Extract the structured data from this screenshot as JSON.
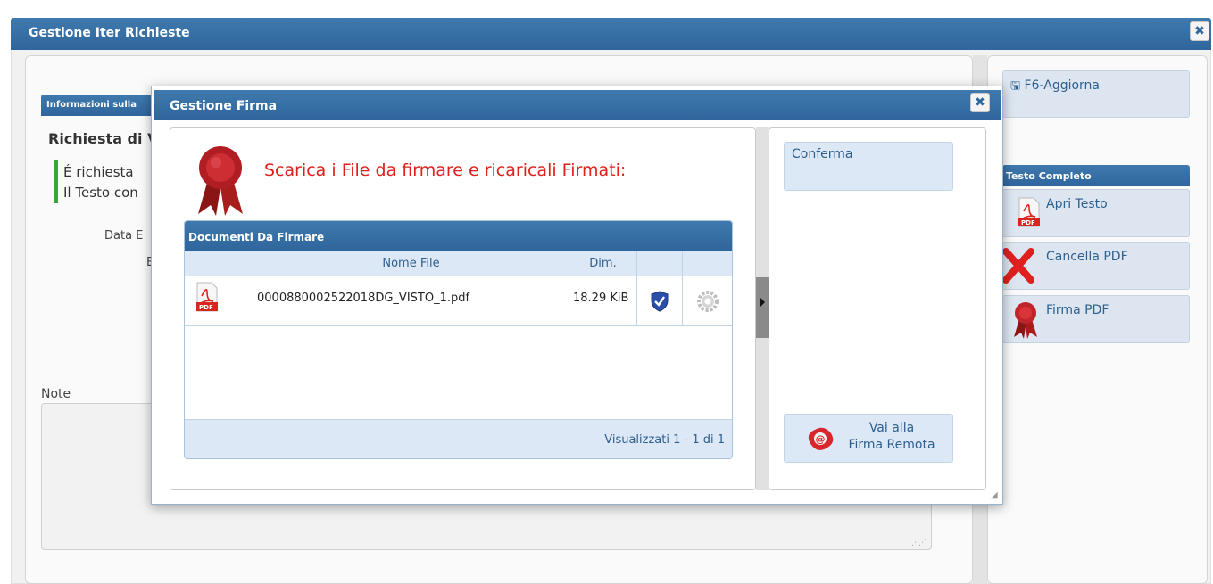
{
  "outer_window": {
    "title": "Gestione Iter Richieste",
    "close_glyph": "✖",
    "info_header": "Informazioni sulla",
    "richiesta_title": "Richiesta di V",
    "lines": [
      "É richiesta",
      "Il Testo con"
    ],
    "data_label": "Data E",
    "e_label": "E",
    "note_label": "Note"
  },
  "right_panel": {
    "aggiorna_label": "F6-Aggiorna",
    "testo_header": "Testo Completo",
    "apri_label": "Apri Testo",
    "cancella_label": "Cancella PDF",
    "firma_label": "Firma PDF"
  },
  "modal": {
    "title": "Gestione Firma",
    "close_glyph": "✖",
    "heading": "Scarica i File da firmare e ricaricali Firmati:",
    "confirm_label": "Conferma",
    "remote_label_line1": "Vai alla",
    "remote_label_line2": "Firma Remota"
  },
  "grid": {
    "title": "Documenti Da Firmare",
    "columns": [
      "",
      "Nome File",
      "Dim.",
      "",
      ""
    ],
    "rows": [
      {
        "icon": "pdf-icon",
        "file_name": "0000880002522018DG_VISTO_1.pdf",
        "size": "18.29 KiB",
        "verify_icon": "shield-check-icon",
        "action_icon": "gear-icon"
      }
    ],
    "footer": "Visualizzati 1 - 1 di 1"
  },
  "colors": {
    "header_blue": "#2f669d",
    "heading_red": "#e0201b",
    "button_bg": "#dde8f6",
    "green_accent": "#3aa53a"
  },
  "icons": {
    "pdf_badge": "PDF",
    "save_glyph": "🖫"
  }
}
